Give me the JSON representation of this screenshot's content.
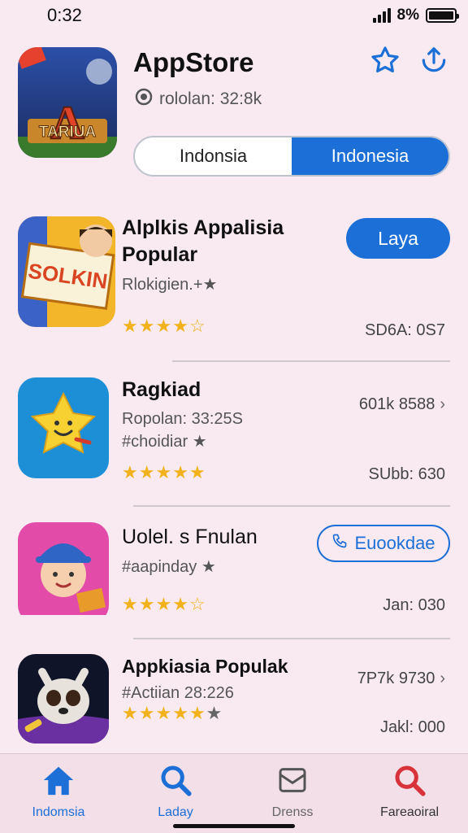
{
  "status": {
    "time": "0:32",
    "network": "8%"
  },
  "header": {
    "title": "AppStore",
    "subtitle": "rololan: 32:8k",
    "icon_text": "TARIUA",
    "icon_letter": "A",
    "segments": [
      "Indonsia",
      "Indonesia"
    ],
    "active_segment": 1
  },
  "apps": [
    {
      "title": "Alplkis Appalisia Popular",
      "subtitle": "Rlokigien.+★",
      "rating": 4,
      "button": "Laya",
      "meta_bottom": "SD6A: 0S7",
      "icon_text": "SOLKIN"
    },
    {
      "title": "Ragkiad",
      "subtitle": "Ropolan: 33:25S",
      "subtitle2": "#choidiar ★",
      "rating": 5,
      "meta_top": "601k 8588",
      "meta_bottom": "SUbb: 630"
    },
    {
      "title": "Uolel. s Fnulan",
      "subtitle": "#aapinday ★",
      "rating": 4,
      "button": "Euookdae",
      "meta_bottom": "Jan: 030"
    },
    {
      "title": "Appkiasia Populak",
      "subtitle": "#Actiian 28:226",
      "rating": 5,
      "meta_top": "7P7k 9730",
      "meta_bottom": "Jakl: 000"
    }
  ],
  "tabs": [
    {
      "label": "Indomsia",
      "icon": "home-icon"
    },
    {
      "label": "Laday",
      "icon": "search-icon"
    },
    {
      "label": "Drenss",
      "icon": "inbox-icon"
    },
    {
      "label": "Fareaoiral",
      "icon": "search-red-icon"
    }
  ],
  "colors": {
    "accent": "#1b6fd6",
    "star": "#f2b21b",
    "background": "#f9eaf1"
  }
}
